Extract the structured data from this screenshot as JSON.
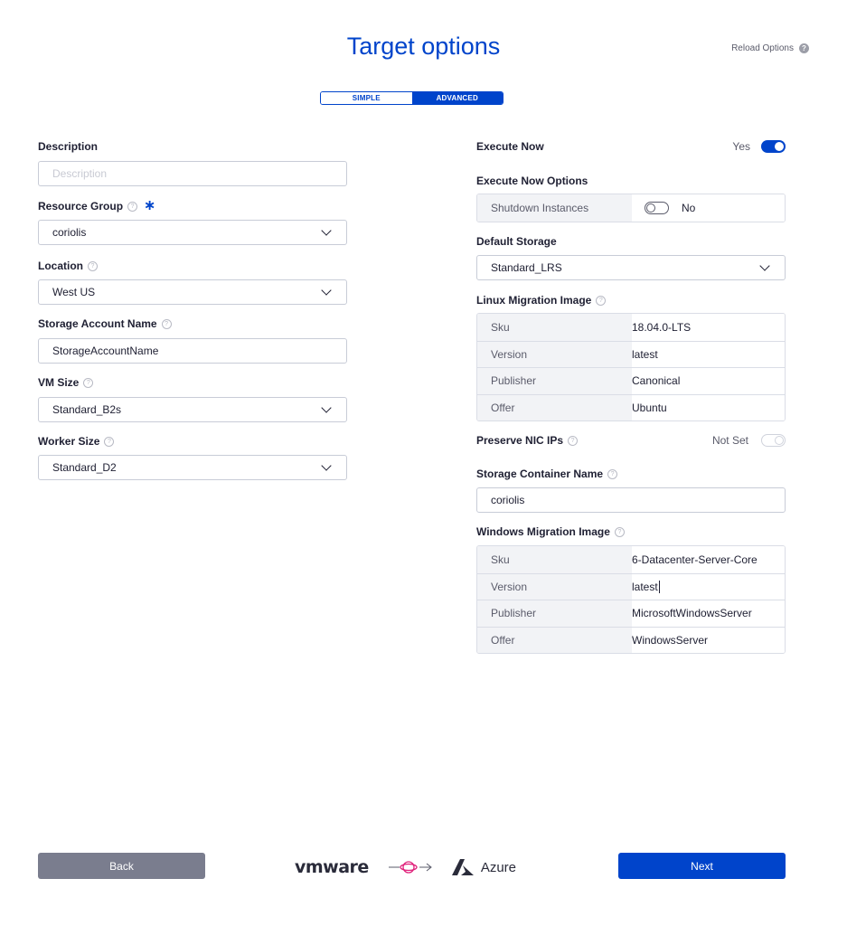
{
  "header": {
    "title": "Target options",
    "reload_label": "Reload Options",
    "help_icon": "help-circle-icon"
  },
  "mode_switcher": {
    "simple": "SIMPLE",
    "advanced": "ADVANCED",
    "selected": "ADVANCED"
  },
  "left": {
    "description": {
      "label": "Description",
      "placeholder": "Description",
      "value": ""
    },
    "resource_group": {
      "label": "Resource Group",
      "value": "coriolis",
      "required": "∗"
    },
    "location": {
      "label": "Location",
      "value": "West US"
    },
    "storage_account": {
      "label": "Storage Account Name",
      "value": "StorageAccountName"
    },
    "vm_size": {
      "label": "VM Size",
      "value": "Standard_B2s"
    },
    "worker_size": {
      "label": "Worker Size",
      "value": "Standard_D2"
    }
  },
  "right": {
    "execute_now": {
      "label": "Execute Now",
      "value_label": "Yes",
      "on": true
    },
    "execute_now_options": {
      "label": "Execute Now Options",
      "key": "Shutdown Instances",
      "value_label": "No",
      "on": false
    },
    "default_storage": {
      "label": "Default Storage",
      "value": "Standard_LRS"
    },
    "linux_image": {
      "label": "Linux Migration Image",
      "rows": [
        {
          "key": "Sku",
          "value": "18.04.0-LTS"
        },
        {
          "key": "Version",
          "value": "latest"
        },
        {
          "key": "Publisher",
          "value": "Canonical"
        },
        {
          "key": "Offer",
          "value": "Ubuntu"
        }
      ]
    },
    "preserve_nic": {
      "label": "Preserve NIC IPs",
      "value_label": "Not Set"
    },
    "storage_container": {
      "label": "Storage Container Name",
      "value": "coriolis"
    },
    "windows_image": {
      "label": "Windows Migration Image",
      "rows": [
        {
          "key": "Sku",
          "value": "6-Datacenter-Server-Core"
        },
        {
          "key": "Version",
          "value": "latest"
        },
        {
          "key": "Publisher",
          "value": "MicrosoftWindowsServer"
        },
        {
          "key": "Offer",
          "value": "WindowsServer"
        }
      ]
    }
  },
  "footer": {
    "back_label": "Back",
    "next_label": "Next",
    "source_brand": "vmware",
    "target_brand": "Azure"
  },
  "colors": {
    "accent": "#0044cb",
    "back_button": "#7a7d8e",
    "text": "#202134"
  }
}
